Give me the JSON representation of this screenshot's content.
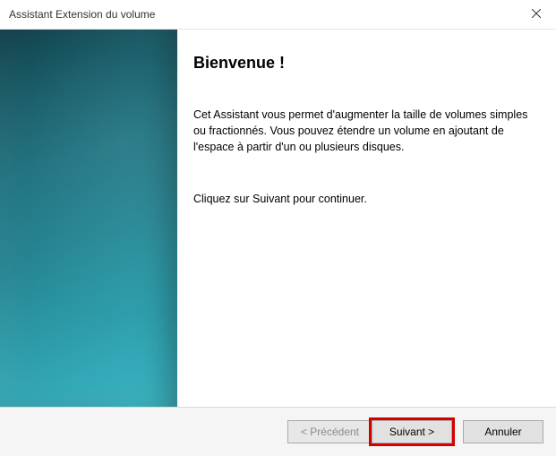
{
  "window": {
    "title": "Assistant Extension du volume"
  },
  "content": {
    "heading": "Bienvenue !",
    "description": "Cet Assistant vous permet d'augmenter la taille de volumes simples ou fractionnés. Vous pouvez étendre un volume en ajoutant de l'espace à partir d'un ou plusieurs disques.",
    "hint": "Cliquez sur Suivant pour continuer."
  },
  "footer": {
    "back_label": "< Précédent",
    "next_label": "Suivant >",
    "cancel_label": "Annuler"
  }
}
